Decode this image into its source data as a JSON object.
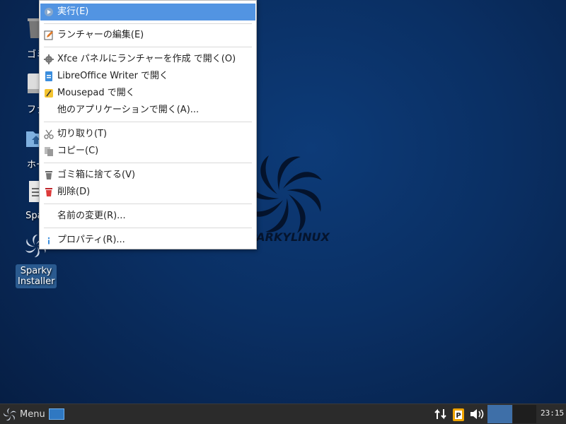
{
  "desktop": {
    "icons": [
      {
        "label": "ゴミ",
        "icon": "trash-icon"
      },
      {
        "label": "ファ",
        "icon": "drive-icon"
      },
      {
        "label": "ホー",
        "icon": "home-folder-icon"
      },
      {
        "label": "Spar",
        "icon": "text-file-icon"
      },
      {
        "label": "Sparky Installer",
        "icon": "sparky-installer-icon"
      }
    ],
    "wallpaper_text": "PARKYLINUX"
  },
  "context_menu": {
    "items": [
      {
        "label": "実行(E)",
        "icon": "execute-icon",
        "active": true
      },
      {
        "label": "ランチャーの編集(E)",
        "icon": "edit-icon"
      },
      {
        "label": "Xfce パネルにランチャーを作成  で開く(O)",
        "icon": "gear-icon"
      },
      {
        "label": "LibreOffice Writer で開く",
        "icon": "writer-icon"
      },
      {
        "label": "Mousepad で開く",
        "icon": "mousepad-icon"
      },
      {
        "label": "他のアプリケーションで開く(A)...",
        "icon": ""
      },
      {
        "label": "切り取り(T)",
        "icon": "cut-icon"
      },
      {
        "label": "コピー(C)",
        "icon": "copy-icon"
      },
      {
        "label": "ゴミ箱に捨てる(V)",
        "icon": "trash-icon"
      },
      {
        "label": "削除(D)",
        "icon": "delete-icon"
      },
      {
        "label": "名前の変更(R)...",
        "icon": ""
      },
      {
        "label": "プロパティ(R)...",
        "icon": "info-icon"
      }
    ]
  },
  "panel": {
    "menu_label": "Menu",
    "clock": "23:15",
    "tray_icons": [
      "network-icon",
      "clipboard-icon",
      "volume-icon"
    ]
  }
}
